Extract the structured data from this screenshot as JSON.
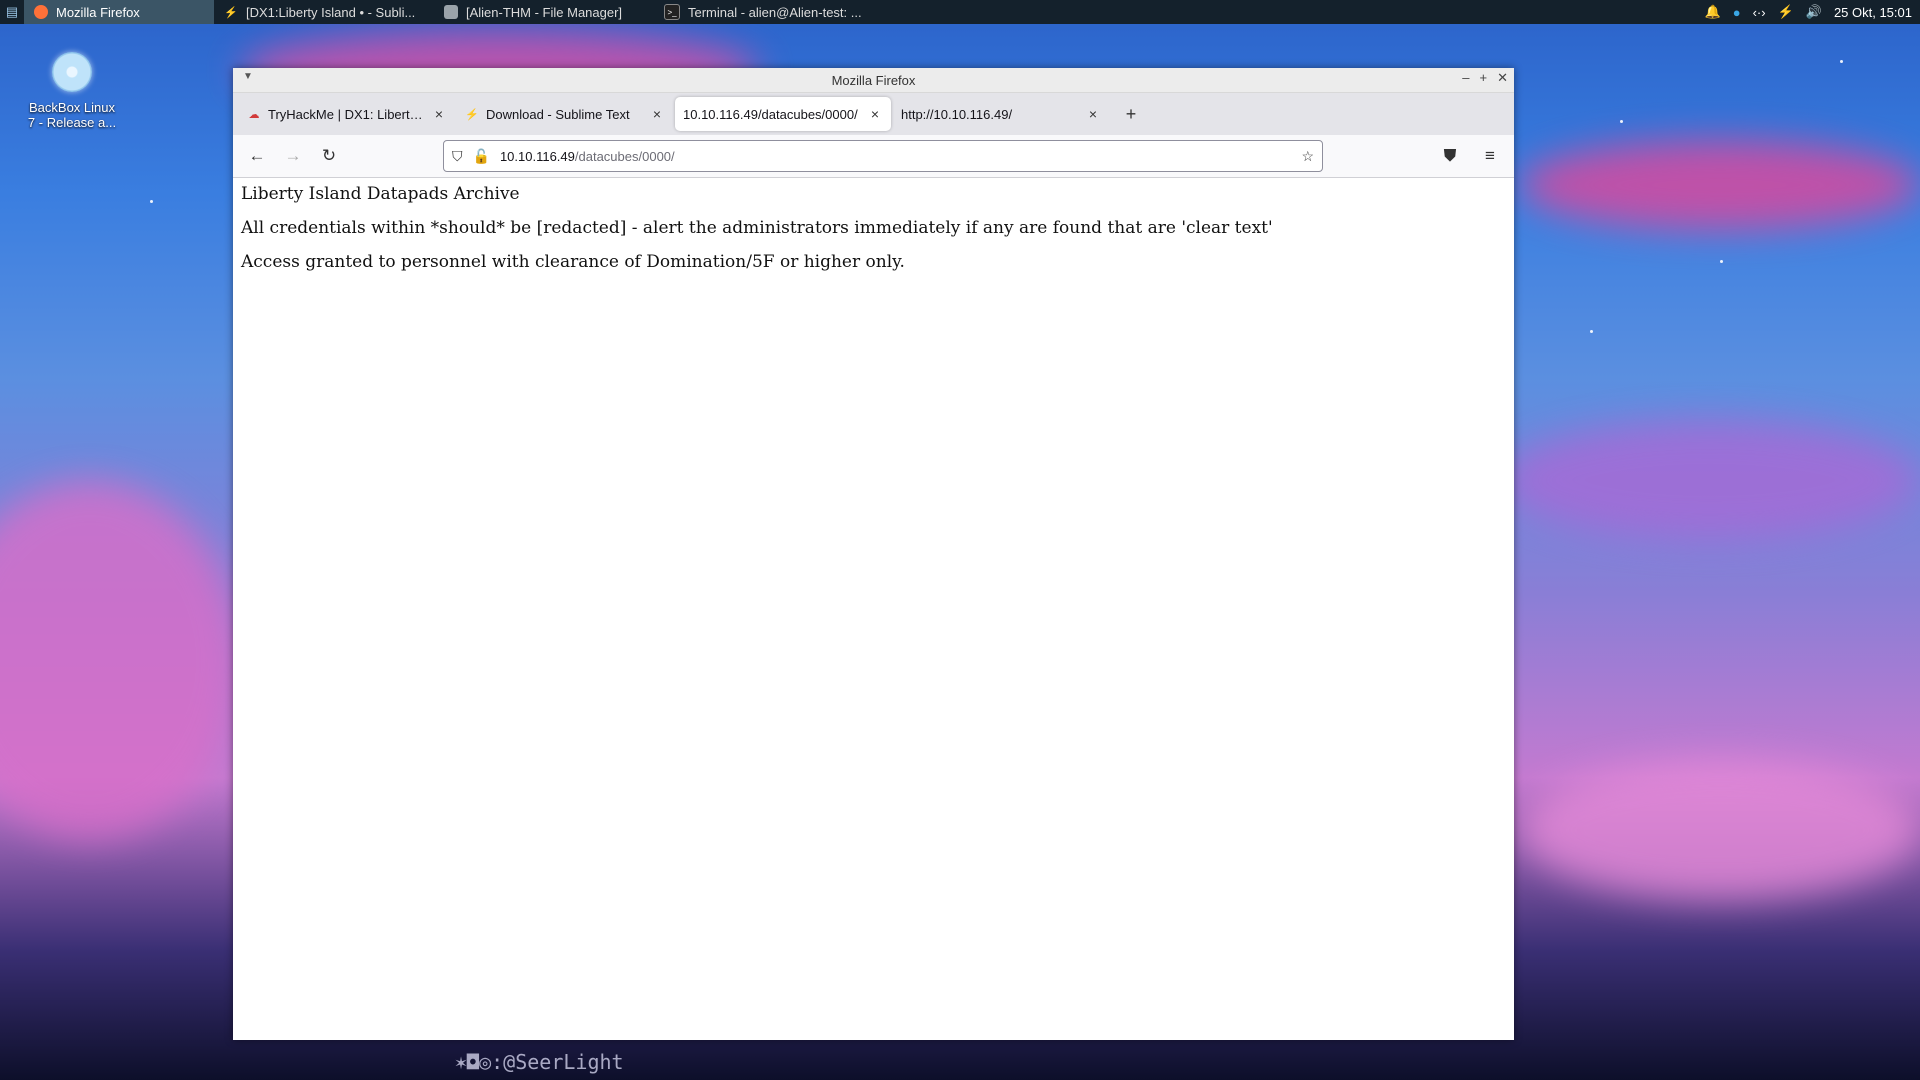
{
  "desktop": {
    "icon_label_line1": "BackBox Linux",
    "icon_label_line2": "7 - Release a..."
  },
  "panel": {
    "tasks": [
      {
        "label": "Mozilla Firefox",
        "icon": "firefox-icon"
      },
      {
        "label": "[DX1:Liberty Island • - Subli...",
        "icon": "sublime-icon"
      },
      {
        "label": "[Alien-THM - File Manager]",
        "icon": "folder-icon"
      },
      {
        "label": "Terminal - alien@Alien-test: ...",
        "icon": "terminal-icon"
      }
    ],
    "clock": "25 Okt, 15:01"
  },
  "window": {
    "title": "Mozilla Firefox",
    "tabs": [
      {
        "title": "TryHackMe | DX1: Liberty Isla",
        "icon": "tryhackme-icon",
        "selected": false
      },
      {
        "title": "Download - Sublime Text",
        "icon": "sublime-icon",
        "selected": false
      },
      {
        "title": "10.10.116.49/datacubes/0000/",
        "icon": "",
        "selected": true
      },
      {
        "title": "http://10.10.116.49/",
        "icon": "",
        "selected": false
      }
    ],
    "url_host": "10.10.116.49",
    "url_path": "/datacubes/0000/"
  },
  "page": {
    "heading": "Liberty Island Datapads Archive",
    "line1": "All credentials within *should* be [redacted] - alert the administrators immediately if any are found that are 'clear text'",
    "line2": "Access granted to personnel with clearance of Domination/5F or higher only."
  },
  "watermark": "@SeerLight"
}
